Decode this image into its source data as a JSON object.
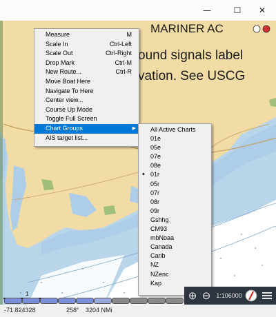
{
  "window": {
    "minimize_glyph": "—",
    "maximize_glyph": "☐",
    "close_glyph": "✕"
  },
  "chart_notice": {
    "line1": "MARINER AC",
    "line2": "ound signals label",
    "line3": "vation. See USCG"
  },
  "context_menu": {
    "items": [
      {
        "label": "Measure",
        "accel": "M"
      },
      {
        "label": "Scale In",
        "accel": "Ctrl-Left"
      },
      {
        "label": "Scale Out",
        "accel": "Ctrl-Right"
      },
      {
        "label": "Drop Mark",
        "accel": "Ctrl-M"
      },
      {
        "label": "New Route...",
        "accel": "Ctrl-R"
      },
      {
        "label": "Move Boat Here",
        "accel": ""
      },
      {
        "label": "Navigate To Here",
        "accel": ""
      },
      {
        "label": "Center view...",
        "accel": ""
      },
      {
        "label": "Course Up Mode",
        "accel": ""
      },
      {
        "label": "Toggle Full Screen",
        "accel": ""
      },
      {
        "label": "Chart Groups",
        "accel": ""
      },
      {
        "label": "AIS target list...",
        "accel": ""
      }
    ],
    "highlighted_index": 10,
    "submenu_arrow": "▶"
  },
  "chart_groups_submenu": {
    "items": [
      "All Active Charts",
      "01e",
      "05e",
      "07e",
      "08e",
      "01r",
      "05r",
      "07r",
      "08r",
      "09r",
      "Gshhg",
      "CM93",
      "mbNoaa",
      "Canada",
      "Carib",
      "NZ",
      "NZenc",
      "Kap"
    ],
    "selected_index": 5
  },
  "scale_bar": {
    "label": "1 NMi"
  },
  "toolbar": {
    "scale": "1:106000"
  },
  "status": {
    "longitude": "-71.824328",
    "course": "258°",
    "distance": "3204 NMi"
  },
  "colors": {
    "land": "#f2dca6",
    "shallow": "#aecde8",
    "deep": "#ffffff",
    "menu_highlight": "#0078d7",
    "toolbar": "#2d3540"
  }
}
